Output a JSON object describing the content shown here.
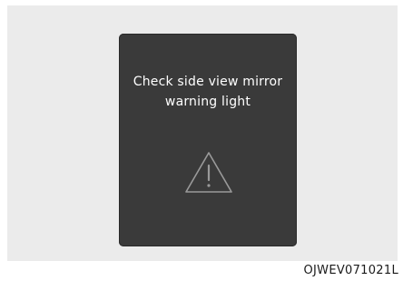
{
  "screen": {
    "message_line1": "Check side view mirror",
    "message_line2": "warning light",
    "icon": "warning-triangle-icon"
  },
  "caption": {
    "image_code": "OJWEV071021L"
  },
  "colors": {
    "screen_background": "#3a3a3a",
    "panel_background": "#ebebeb",
    "text": "#ffffff",
    "icon_stroke": "#9a9a9a"
  }
}
